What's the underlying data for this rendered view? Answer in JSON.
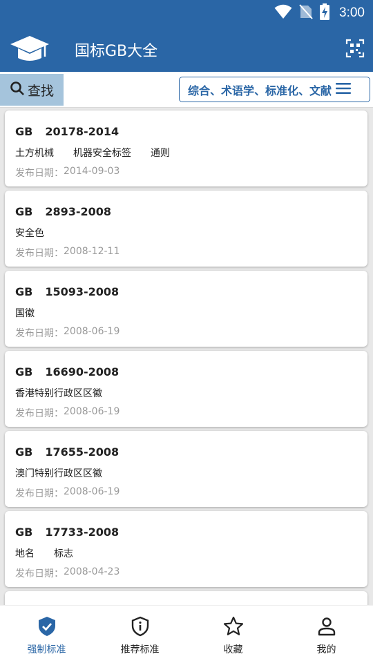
{
  "status": {
    "time": "3:00"
  },
  "app": {
    "title": "国标GB大全"
  },
  "filter": {
    "search_label": "查找",
    "category_label": "综合、术语学、标准化、文献"
  },
  "cards": [
    {
      "prefix": "GB",
      "number": "20178-2014",
      "tags": [
        "土方机械",
        "机器安全标签",
        "通则"
      ],
      "date_label": "发布日期：",
      "date": "2014-09-03"
    },
    {
      "prefix": "GB",
      "number": "2893-2008",
      "tags": [
        "安全色"
      ],
      "date_label": "发布日期：",
      "date": "2008-12-11"
    },
    {
      "prefix": "GB",
      "number": "15093-2008",
      "tags": [
        "国徽"
      ],
      "date_label": "发布日期：",
      "date": "2008-06-19"
    },
    {
      "prefix": "GB",
      "number": "16690-2008",
      "tags": [
        "香港特别行政区区徽"
      ],
      "date_label": "发布日期：",
      "date": "2008-06-19"
    },
    {
      "prefix": "GB",
      "number": "17655-2008",
      "tags": [
        "澳门特别行政区区徽"
      ],
      "date_label": "发布日期：",
      "date": "2008-06-19"
    },
    {
      "prefix": "GB",
      "number": "17733-2008",
      "tags": [
        "地名",
        "标志"
      ],
      "date_label": "发布日期：",
      "date": "2008-04-23"
    }
  ],
  "nav": [
    {
      "label": "强制标准",
      "icon": "shield-check-icon",
      "active": true
    },
    {
      "label": "推荐标准",
      "icon": "shield-info-icon",
      "active": false
    },
    {
      "label": "收藏",
      "icon": "star-icon",
      "active": false
    },
    {
      "label": "我的",
      "icon": "person-icon",
      "active": false
    }
  ],
  "colors": {
    "primary": "#2a66a6",
    "search_tab_bg": "#a5c4dc",
    "date_text": "#999999"
  }
}
